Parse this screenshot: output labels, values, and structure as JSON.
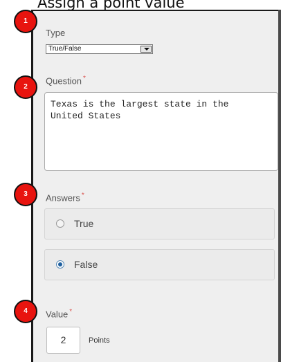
{
  "heading": {
    "number": "",
    "text": "Assign a point value"
  },
  "form": {
    "type": {
      "label": "Type",
      "selected": "True/False"
    },
    "question": {
      "label": "Question",
      "required": "*",
      "text": "Texas is the largest state in the\nUnited States"
    },
    "answers": {
      "label": "Answers",
      "required": "*",
      "options": [
        {
          "label": "True",
          "selected": false
        },
        {
          "label": "False",
          "selected": true
        }
      ]
    },
    "value": {
      "label": "Value",
      "required": "*",
      "points": "2",
      "unit": "Points"
    }
  },
  "callouts": [
    "1",
    "2",
    "3",
    "4"
  ],
  "colors": {
    "callout": "#e8140f",
    "radio_selected": "#1f5f9e",
    "required": "#d9534f"
  }
}
